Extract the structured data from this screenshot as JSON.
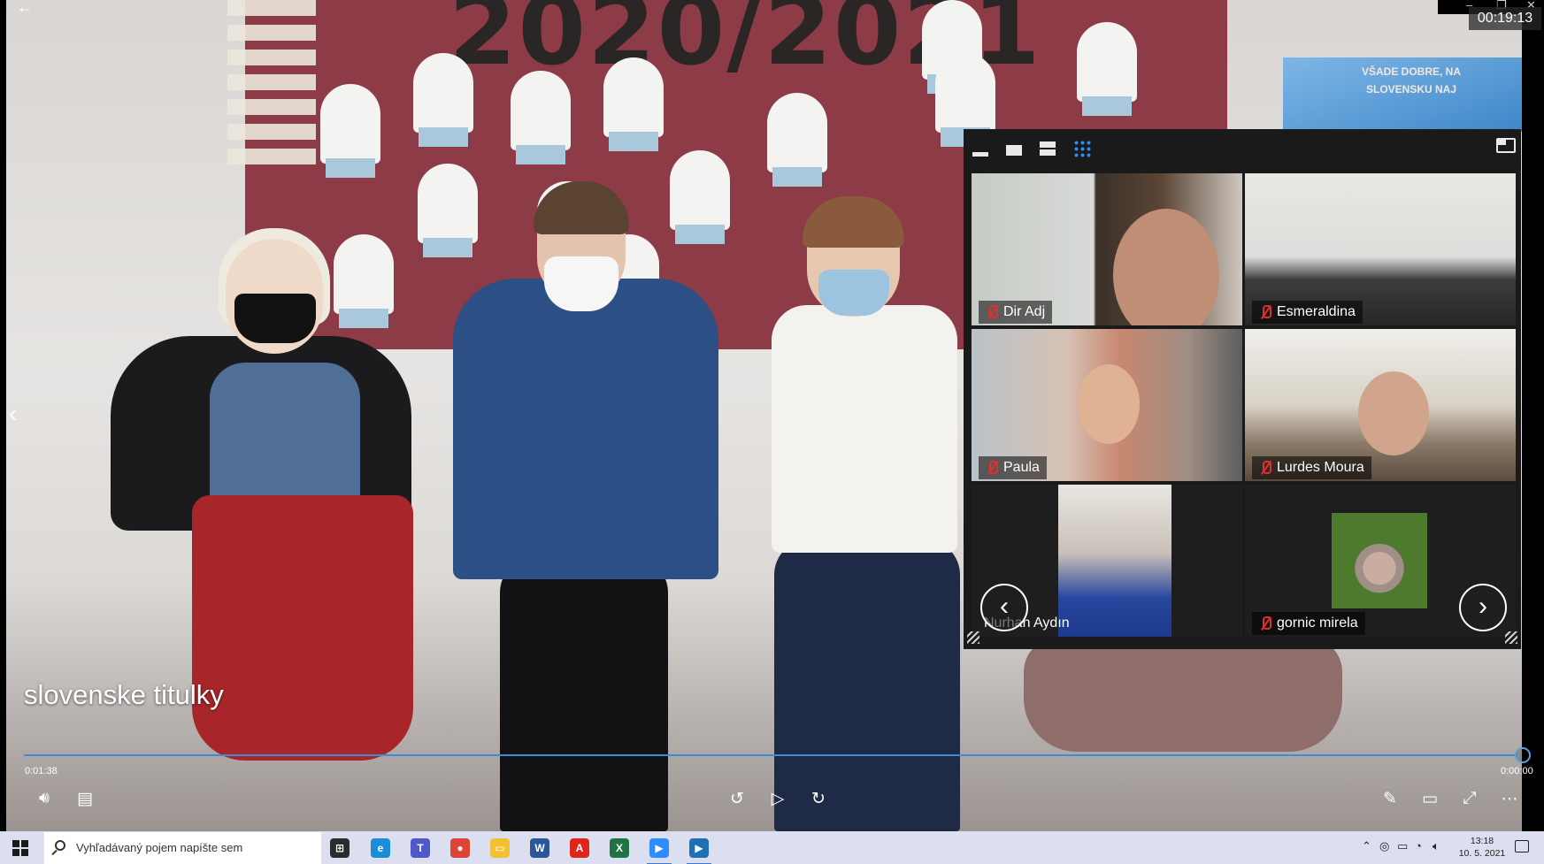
{
  "player": {
    "timer": "00:19:13",
    "subtitle": "slovenske titulky",
    "elapsed": "0:01:38",
    "total": "0:00:00",
    "progress_fraction": 0.999,
    "board_year": "2020/2021",
    "map_text": "VŠADE DOBRE, NA SLOVENSKU NAJ"
  },
  "zoom": {
    "view_icons": [
      "minimize-icon",
      "speaker-view-icon",
      "side-by-side-icon",
      "gallery-grid-icon"
    ],
    "participants": [
      {
        "name": "Dir Adj",
        "muted": true
      },
      {
        "name": "Esmeraldina",
        "muted": true
      },
      {
        "name": "Paula",
        "muted": true
      },
      {
        "name": "Lurdes Moura",
        "muted": true
      },
      {
        "name": "Nurhan Aydın",
        "muted": false
      },
      {
        "name": "gornic mirela",
        "muted": true
      }
    ]
  },
  "taskbar": {
    "search_placeholder": "Vyhľadávaný pojem napíšte sem",
    "apps": [
      {
        "name": "task-view",
        "label": "⊞",
        "color": "#2b2b2b"
      },
      {
        "name": "edge",
        "label": "e",
        "color": "#1b8cd8"
      },
      {
        "name": "teams",
        "label": "T",
        "color": "#5059c9"
      },
      {
        "name": "chrome",
        "label": "●",
        "color": "#db4437"
      },
      {
        "name": "file-explorer",
        "label": "▭",
        "color": "#f2c131"
      },
      {
        "name": "word",
        "label": "W",
        "color": "#2b579a"
      },
      {
        "name": "acrobat",
        "label": "A",
        "color": "#e1251b"
      },
      {
        "name": "excel",
        "label": "X",
        "color": "#217346"
      },
      {
        "name": "zoom",
        "label": "▶",
        "color": "#2d8cff"
      },
      {
        "name": "video-player",
        "label": "▶",
        "color": "#1f6fb5"
      }
    ],
    "time": "13:18",
    "date": "10. 5. 2021"
  }
}
